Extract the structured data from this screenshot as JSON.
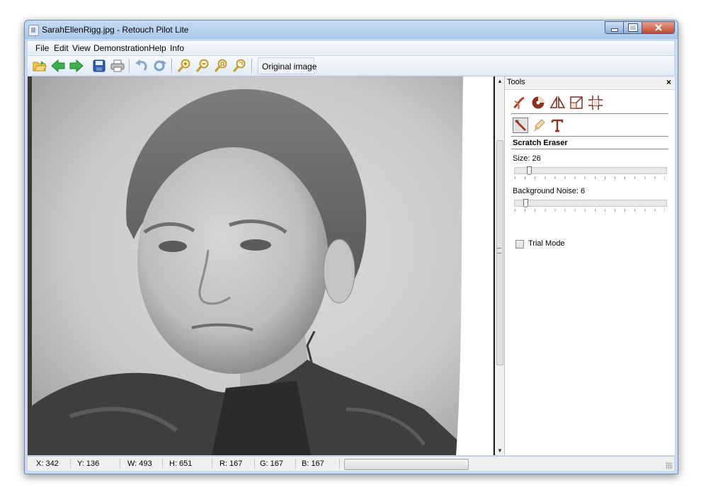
{
  "window": {
    "title": "SarahEllenRigg.jpg - Retouch Pilot Lite"
  },
  "menu": {
    "items": [
      "File",
      "Edit",
      "View",
      "Demonstration",
      "Help",
      "Info"
    ]
  },
  "toolbar": {
    "buttons": [
      "open-icon",
      "back-icon",
      "forward-icon",
      "save-icon",
      "print-icon",
      "undo-icon",
      "redo-icon",
      "zoom-in-icon",
      "zoom-out-icon",
      "zoom-fit-icon",
      "zoom-actual-icon"
    ],
    "original_image_label": "Original image"
  },
  "tools": {
    "title": "Tools",
    "close": "×",
    "row1_icons": [
      "retouch-brush-icon",
      "color-wheel-icon",
      "perspective-icon",
      "crop-icon",
      "grid-icon"
    ],
    "row2_icons": [
      "scratch-eraser-icon",
      "smudge-brush-icon",
      "text-icon"
    ],
    "selected_tool": "Scratch Eraser",
    "size_label": "Size: 26",
    "size_value": 26,
    "noise_label": "Background Noise: 6",
    "noise_value": 6,
    "trial_mode_label": "Trial Mode",
    "trial_mode_checked": false
  },
  "status": {
    "x": "X: 342",
    "y": "Y: 136",
    "w": "W: 493",
    "h": "H: 651",
    "r": "R: 167",
    "g": "G: 167",
    "b": "B: 167"
  },
  "colors": {
    "title_gradient_top": "#c7dcf3",
    "close_button": "#c14a31",
    "panel_bg": "#f0f0f0"
  }
}
